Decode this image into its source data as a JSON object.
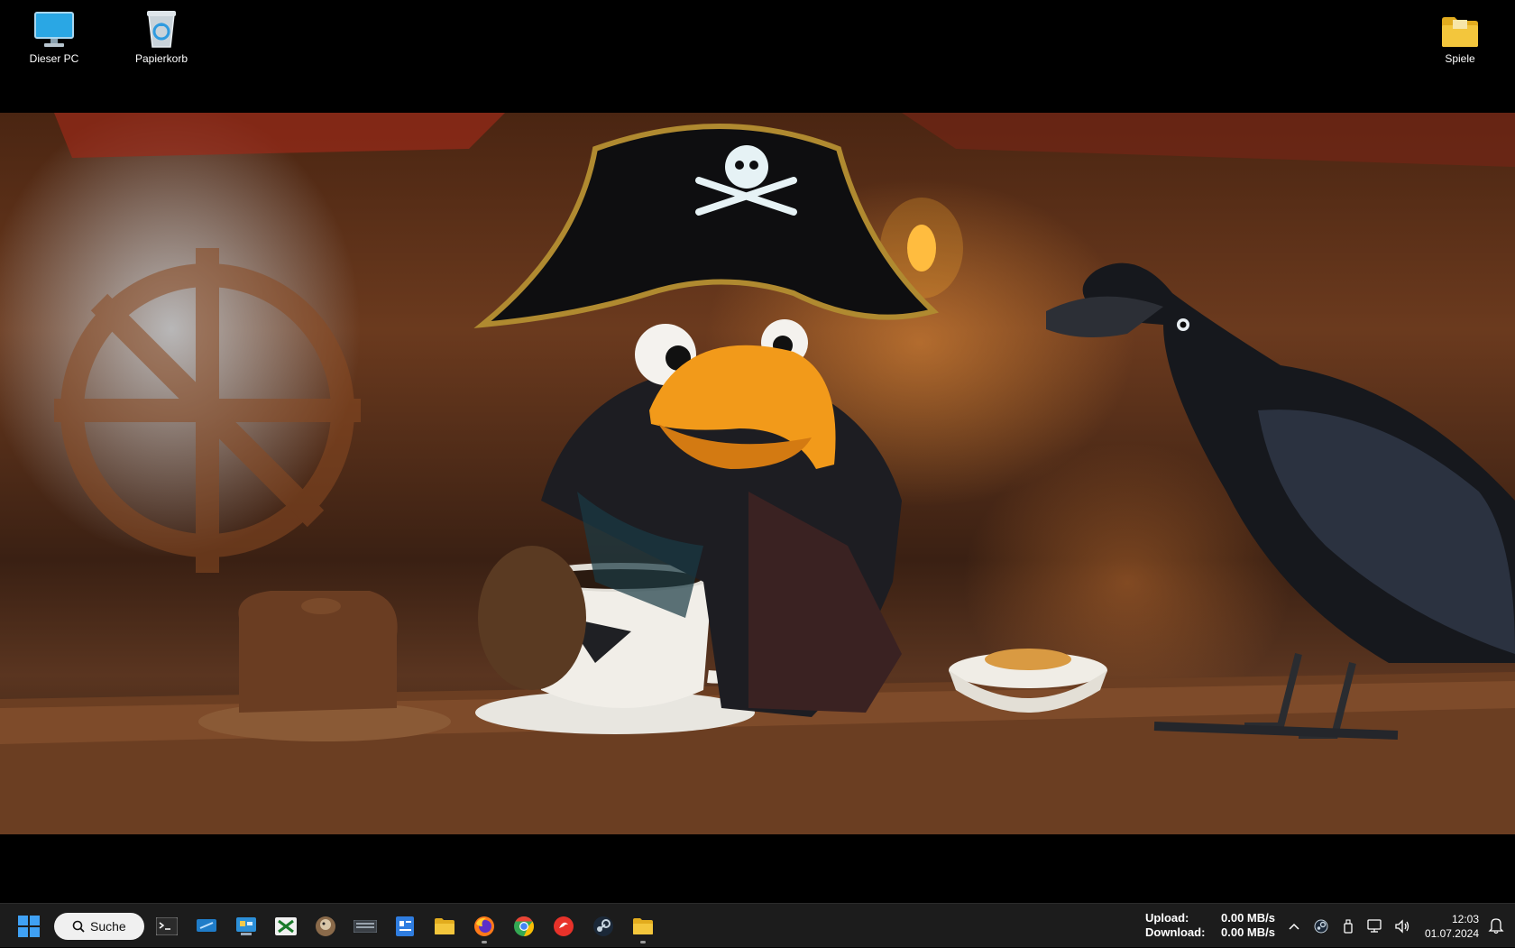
{
  "desktop": {
    "icons_left": [
      {
        "label": "Dieser PC",
        "icon": "this-pc-monitor-icon"
      },
      {
        "label": "Papierkorb",
        "icon": "recycle-bin-icon"
      }
    ],
    "icons_right": [
      {
        "label": "Spiele",
        "icon": "folder-icon"
      }
    ],
    "wallpaper": {
      "description_icon": "pirate-bird-wallpaper"
    }
  },
  "taskbar": {
    "search_label": "Suche",
    "apps": [
      {
        "name": "terminal",
        "running": false
      },
      {
        "name": "remote-desktop",
        "running": false
      },
      {
        "name": "control-panel",
        "running": false
      },
      {
        "name": "xnview",
        "running": false
      },
      {
        "name": "gimp",
        "running": false
      },
      {
        "name": "keyboard-app",
        "running": false
      },
      {
        "name": "id-app",
        "running": false
      },
      {
        "name": "file-explorer",
        "running": false
      },
      {
        "name": "firefox",
        "running": true
      },
      {
        "name": "chrome",
        "running": false
      },
      {
        "name": "red-app",
        "running": false
      },
      {
        "name": "steam",
        "running": false
      },
      {
        "name": "file-explorer-open",
        "running": true
      }
    ],
    "network": {
      "upload_label": "Upload:",
      "upload_value": "0.00 MB/s",
      "download_label": "Download:",
      "download_value": "0.00 MB/s"
    },
    "tray_chevron": "^",
    "clock": {
      "time": "12:03",
      "date": "01.07.2024"
    }
  },
  "colors": {
    "taskbar_bg": "#1c1c1c",
    "start_blue": "#3fa1f5",
    "folder_yellow": "#f3c63c"
  }
}
